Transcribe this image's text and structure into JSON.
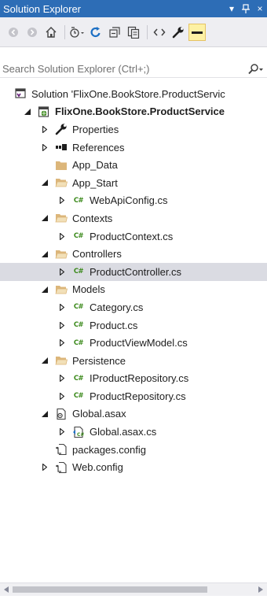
{
  "window": {
    "title": "Solution Explorer",
    "menu_glyph": "▾",
    "pin_glyph": "⩎",
    "close_glyph": "×"
  },
  "search": {
    "placeholder": "Search Solution Explorer (Ctrl+;)"
  },
  "tree": [
    {
      "label": "Solution 'FlixOne.BookStore.ProductServic",
      "icon": "solution-icon",
      "indent": 18,
      "arrow": "none"
    },
    {
      "label": "FlixOne.BookStore.ProductService",
      "icon": "project-icon",
      "indent": 30,
      "arrow": "expanded",
      "bold": true
    },
    {
      "label": "Properties",
      "icon": "wrench-icon",
      "indent": 52,
      "arrow": "collapsed"
    },
    {
      "label": "References",
      "icon": "references-icon",
      "indent": 52,
      "arrow": "collapsed"
    },
    {
      "label": "App_Data",
      "icon": "folder-icon",
      "indent": 52,
      "arrow": "none"
    },
    {
      "label": "App_Start",
      "icon": "folder-open-icon",
      "indent": 52,
      "arrow": "expanded"
    },
    {
      "label": "WebApiConfig.cs",
      "icon": "csharp-file-icon",
      "indent": 74,
      "arrow": "collapsed"
    },
    {
      "label": "Contexts",
      "icon": "folder-open-icon",
      "indent": 52,
      "arrow": "expanded"
    },
    {
      "label": "ProductContext.cs",
      "icon": "csharp-file-icon",
      "indent": 74,
      "arrow": "collapsed"
    },
    {
      "label": "Controllers",
      "icon": "folder-open-icon",
      "indent": 52,
      "arrow": "expanded"
    },
    {
      "label": "ProductController.cs",
      "icon": "csharp-file-icon",
      "indent": 74,
      "arrow": "collapsed",
      "selected": true
    },
    {
      "label": "Models",
      "icon": "folder-open-icon",
      "indent": 52,
      "arrow": "expanded"
    },
    {
      "label": "Category.cs",
      "icon": "csharp-file-icon",
      "indent": 74,
      "arrow": "collapsed"
    },
    {
      "label": "Product.cs",
      "icon": "csharp-file-icon",
      "indent": 74,
      "arrow": "collapsed"
    },
    {
      "label": "ProductViewModel.cs",
      "icon": "csharp-file-icon",
      "indent": 74,
      "arrow": "collapsed"
    },
    {
      "label": "Persistence",
      "icon": "folder-open-icon",
      "indent": 52,
      "arrow": "expanded"
    },
    {
      "label": "IProductRepository.cs",
      "icon": "csharp-file-icon",
      "indent": 74,
      "arrow": "collapsed"
    },
    {
      "label": "ProductRepository.cs",
      "icon": "csharp-file-icon",
      "indent": 74,
      "arrow": "collapsed"
    },
    {
      "label": "Global.asax",
      "icon": "asax-icon",
      "indent": 52,
      "arrow": "expanded"
    },
    {
      "label": "Global.asax.cs",
      "icon": "asax-cs-icon",
      "indent": 74,
      "arrow": "collapsed"
    },
    {
      "label": "packages.config",
      "icon": "config-icon",
      "indent": 52,
      "arrow": "none"
    },
    {
      "label": "Web.config",
      "icon": "config-icon",
      "indent": 52,
      "arrow": "collapsed"
    }
  ],
  "colors": {
    "title_bar": "#2d6db6",
    "toolbar": "#eeeef2",
    "selection": "#dadbe2",
    "folder": "#dcb67a",
    "csharp": "#3c8a1c"
  }
}
